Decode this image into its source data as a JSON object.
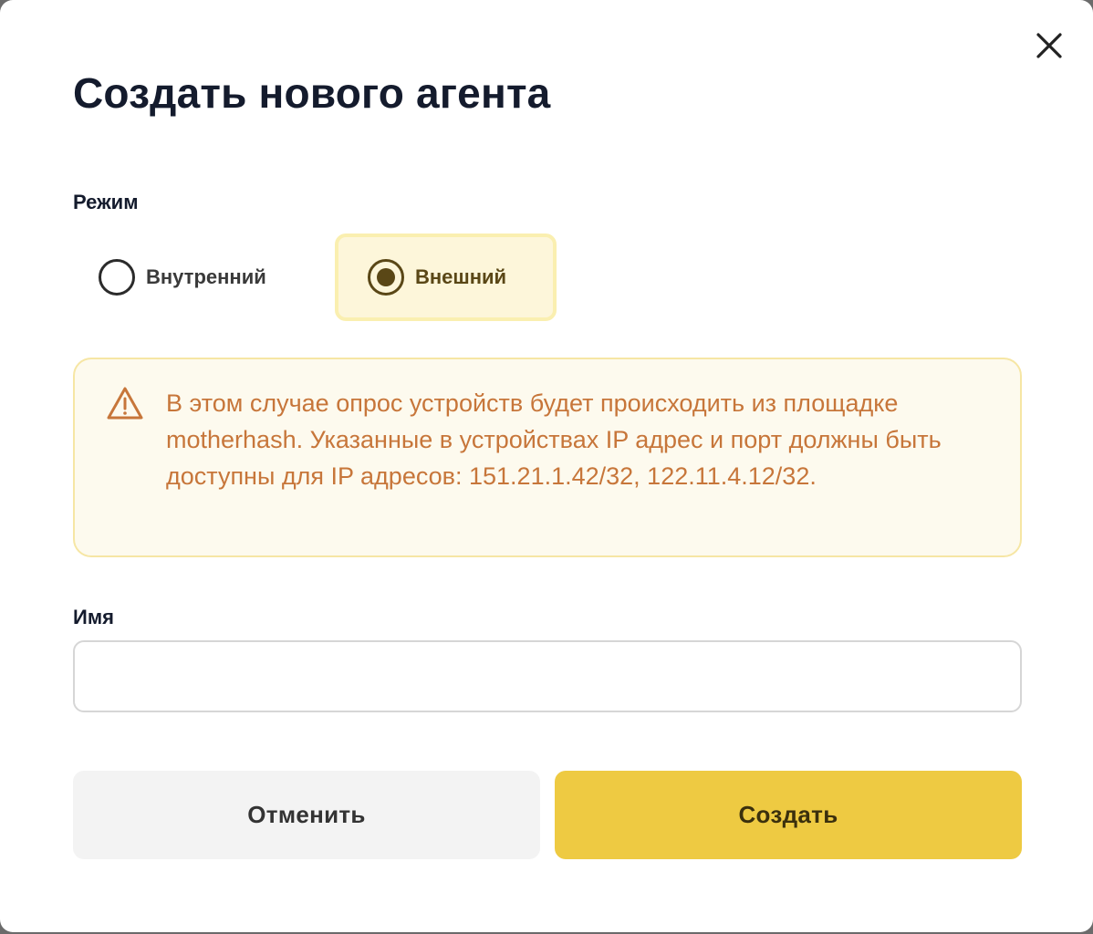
{
  "dialog": {
    "title": "Создать нового агента",
    "close_icon": "close-icon"
  },
  "mode": {
    "label": "Режим",
    "options": [
      {
        "label": "Внутренний",
        "selected": false
      },
      {
        "label": "Внешний",
        "selected": true
      }
    ]
  },
  "alert": {
    "icon": "warning-icon",
    "text": "В этом случае опрос устройств будет происходить из площадке motherhash. Указанные в устройствах IP адрес и порт должны быть доступны для IP адресов: 151.21.1.42/32, 122.11.4.12/32."
  },
  "name_field": {
    "label": "Имя",
    "value": "",
    "placeholder": ""
  },
  "actions": {
    "cancel_label": "Отменить",
    "create_label": "Создать"
  },
  "colors": {
    "accent": "#eeca42",
    "selected_bg": "#fdf6da",
    "selected_border": "#faefb0",
    "alert_text": "#c7763a",
    "alert_bg": "#fdfaee",
    "alert_border": "#f6e6a4",
    "title": "#141b2d"
  }
}
